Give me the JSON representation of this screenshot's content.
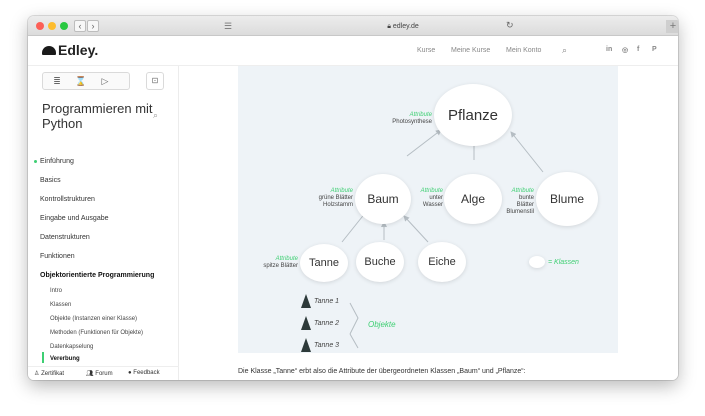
{
  "browser": {
    "url": "edley.de",
    "lock_icon": "lock-icon",
    "back": "‹",
    "forward": "›",
    "reload": "↻",
    "new_tab": "+"
  },
  "header": {
    "logo": "Edley.",
    "nav": [
      "Kurse",
      "Meine Kurse",
      "Mein Konto"
    ],
    "search_icon": "⌕",
    "social": [
      "in",
      "◎",
      "f",
      "P"
    ]
  },
  "sidebar": {
    "tools": [
      "≣",
      "⌛",
      "▷",
      "⊡"
    ],
    "course_title": "Programmieren mit Python",
    "search_icon": "⌕",
    "items": [
      {
        "label": "Einführung",
        "active": false,
        "dot": true
      },
      {
        "label": "Basics",
        "active": false
      },
      {
        "label": "Kontrollstrukturen",
        "active": false
      },
      {
        "label": "Eingabe und Ausgabe",
        "active": false
      },
      {
        "label": "Datenstrukturen",
        "active": false
      },
      {
        "label": "Funktionen",
        "active": false
      },
      {
        "label": "Objektorientierte Programmierung",
        "active": true
      }
    ],
    "subitems": [
      {
        "label": "Intro"
      },
      {
        "label": "Klassen"
      },
      {
        "label": "Objekte (Instanzen einer Klasse)"
      },
      {
        "label": "Methoden (Funktionen für Objekte)"
      },
      {
        "label": "Datenkapselung"
      },
      {
        "label": "Vererbung",
        "current": true
      }
    ],
    "footer": [
      "Zertifikat",
      "Forum",
      "Feedback"
    ]
  },
  "diagram": {
    "nodes": {
      "pflanze": "Pflanze",
      "baum": "Baum",
      "alge": "Alge",
      "blume": "Blume",
      "tanne": "Tanne",
      "buche": "Buche",
      "eiche": "Eiche"
    },
    "attr_word": "Attribute",
    "attrs": {
      "pflanze": "Photosynthese",
      "baum": [
        "grüne Blätter",
        "Holzstamm"
      ],
      "alge": [
        "unter",
        "Wasser"
      ],
      "blume": [
        "bunte",
        "Blätter",
        "Blumenstil"
      ],
      "tanne": "spitze Blätter"
    },
    "objects": [
      "Tanne 1",
      "Tanne 2",
      "Tanne 3"
    ],
    "objects_label": "Objekte",
    "legend": "= Klassen"
  },
  "body_text": "Die Klasse „Tanne“ erbt also die Attribute der übergeordneten Klassen „Baum“ und „Pflanze“:",
  "colors": {
    "accent": "#3ecf73",
    "figure_bg": "#eef3f7"
  }
}
